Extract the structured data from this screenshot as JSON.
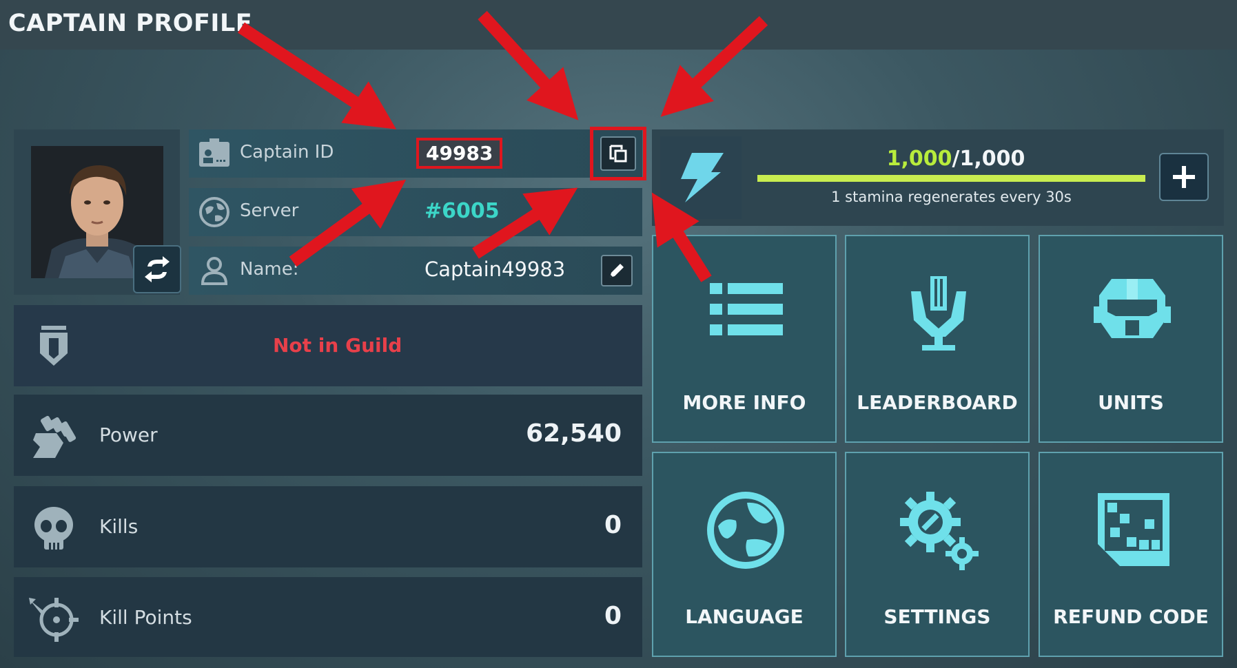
{
  "header": {
    "title": "CAPTAIN PROFILE"
  },
  "profile": {
    "captain_id_label": "Captain ID",
    "captain_id": "49983",
    "server_label": "Server",
    "server": "#6005",
    "name_label": "Name:",
    "name": "Captain49983"
  },
  "guild": {
    "status": "Not in Guild"
  },
  "stats": {
    "power_label": "Power",
    "power": "62,540",
    "kills_label": "Kills",
    "kills": "0",
    "kill_points_label": "Kill Points",
    "kill_points": "0"
  },
  "stamina": {
    "current": "1,000",
    "max": "/1,000",
    "fill_fraction": 1.0,
    "regen_text": "1 stamina regenerates every 30s"
  },
  "tiles": {
    "more_info": "MORE INFO",
    "leaderboard": "LEADERBOARD",
    "units": "UNITS",
    "language": "LANGUAGE",
    "settings": "SETTINGS",
    "refund_code": "REFUND CODE"
  },
  "colors": {
    "accent_cyan": "#6fe0ea",
    "highlight_red": "#e0161e",
    "guild_red": "#e8404a",
    "stamina_green": "#c8ec50"
  }
}
